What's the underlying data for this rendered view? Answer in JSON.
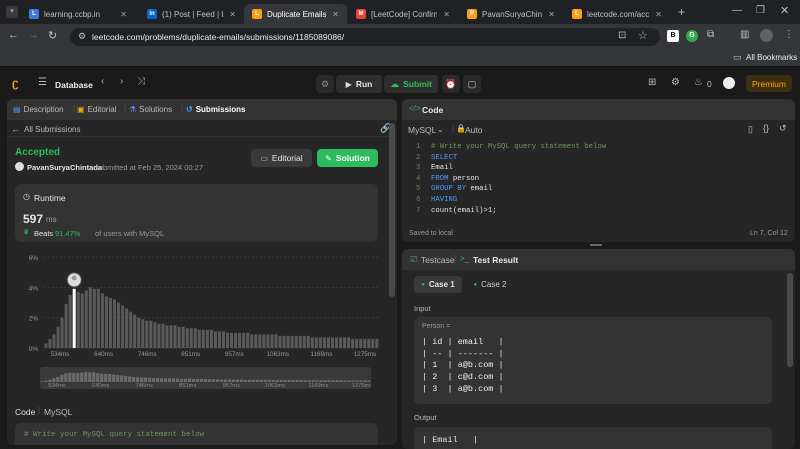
{
  "browser": {
    "tabs": [
      {
        "title": "learning.ccbp.in",
        "icon": "ccbp-icon",
        "color": "#3b7bd6",
        "glyph": "L"
      },
      {
        "title": "(1) Post | Feed | Linke",
        "icon": "linkedin-icon",
        "color": "#0a66c2",
        "glyph": "in"
      },
      {
        "title": "Duplicate Emails - Le",
        "icon": "leetcode-icon",
        "color": "#f89f1b",
        "glyph": "L"
      },
      {
        "title": "[LeetCode] Confirm E",
        "icon": "gmail-icon",
        "color": "#ea4335",
        "glyph": "M"
      },
      {
        "title": "PavanSuryaChintada",
        "icon": "github-icon",
        "color": "#f89f1b",
        "glyph": "P"
      },
      {
        "title": "leetcode.com/accou",
        "icon": "leetcode-icon",
        "color": "#f89f1b",
        "glyph": "L"
      }
    ],
    "new_tab": "+",
    "url": "leetcode.com/problems/duplicate-emails/submissions/1185089086/",
    "all_bookmarks": "All Bookmarks"
  },
  "header": {
    "section": "Database",
    "run": "Run",
    "submit": "Submit",
    "counter": "0",
    "premium": "Premium"
  },
  "left": {
    "tabs": [
      {
        "label": "Description"
      },
      {
        "label": "Editorial"
      },
      {
        "label": "Solutions"
      },
      {
        "label": "Submissions"
      }
    ],
    "back": "All Submissions",
    "status": "Accepted",
    "user": "PavanSuryaChintada",
    "submitted": "submitted at Feb 25, 2024 00:27",
    "editorial_btn": "Editorial",
    "solution_btn": "Solution",
    "runtime_label": "Runtime",
    "runtime_value": "597",
    "runtime_unit": "ms",
    "beats_prefix": "Beats",
    "beats_value": "91.47%",
    "beats_suffix": "of users with MySQL",
    "code_label": "Code",
    "lang_label": "MySQL",
    "code_preview": "# Write your MySQL query statement below"
  },
  "chart_data": {
    "type": "bar",
    "yticks": [
      "6%",
      "4%",
      "2%",
      "0%"
    ],
    "ylim": [
      0,
      6
    ],
    "xticks": [
      "534ms",
      "640ms",
      "746ms",
      "851ms",
      "957ms",
      "1063ms",
      "1169ms",
      "1275ms"
    ],
    "values": [
      0.3,
      0.6,
      0.9,
      1.4,
      2.0,
      2.9,
      3.5,
      3.7,
      3.7,
      3.6,
      3.8,
      4.0,
      3.9,
      3.9,
      3.6,
      3.4,
      3.3,
      3.2,
      3.0,
      2.8,
      2.6,
      2.4,
      2.2,
      2.0,
      1.9,
      1.8,
      1.8,
      1.7,
      1.6,
      1.6,
      1.5,
      1.5,
      1.5,
      1.4,
      1.4,
      1.3,
      1.3,
      1.3,
      1.2,
      1.2,
      1.2,
      1.2,
      1.1,
      1.1,
      1.1,
      1.0,
      1.0,
      1.0,
      1.0,
      1.0,
      1.0,
      0.9,
      0.9,
      0.9,
      0.9,
      0.9,
      0.9,
      0.9,
      0.8,
      0.8,
      0.8,
      0.8,
      0.8,
      0.8,
      0.8,
      0.8,
      0.7,
      0.7,
      0.7,
      0.7,
      0.7,
      0.7,
      0.7,
      0.7,
      0.7,
      0.7,
      0.6,
      0.6,
      0.6,
      0.6,
      0.6,
      0.6,
      0.6
    ],
    "highlight_index": 7,
    "highlight_value": 3.9
  },
  "editor": {
    "title": "Code",
    "language": "MySQL",
    "auto": "Auto",
    "lines": [
      {
        "n": "1",
        "text": "# Write your MySQL query statement below",
        "kind": "comment"
      },
      {
        "n": "2",
        "text": "SELECT",
        "kind": "keyword"
      },
      {
        "n": "3",
        "text": "Email",
        "kind": "plain"
      },
      {
        "n": "4",
        "text": "FROM person",
        "kind": "mixed",
        "kw": "FROM",
        "rest": " person"
      },
      {
        "n": "5",
        "text": "GROUP BY email",
        "kind": "mixed",
        "kw": "GROUP BY",
        "rest": " email"
      },
      {
        "n": "6",
        "text": "HAVING",
        "kind": "keyword"
      },
      {
        "n": "7",
        "text": "count(email)>1;",
        "kind": "plain"
      }
    ],
    "saved": "Saved to local",
    "position": "Ln 7, Col 12"
  },
  "tests": {
    "tab_testcase": "Testcase",
    "tab_result": "Test Result",
    "case1": "Case 1",
    "case2": "Case 2",
    "input_label": "Input",
    "table_name": "Person =",
    "table_lines": [
      "| id | email   |",
      "| -- | ------- |",
      "| 1  | a@b.com |",
      "| 2  | c@d.com |",
      "| 3  | a@b.com |"
    ],
    "output_label": "Output",
    "output_line": "| Email   |"
  }
}
